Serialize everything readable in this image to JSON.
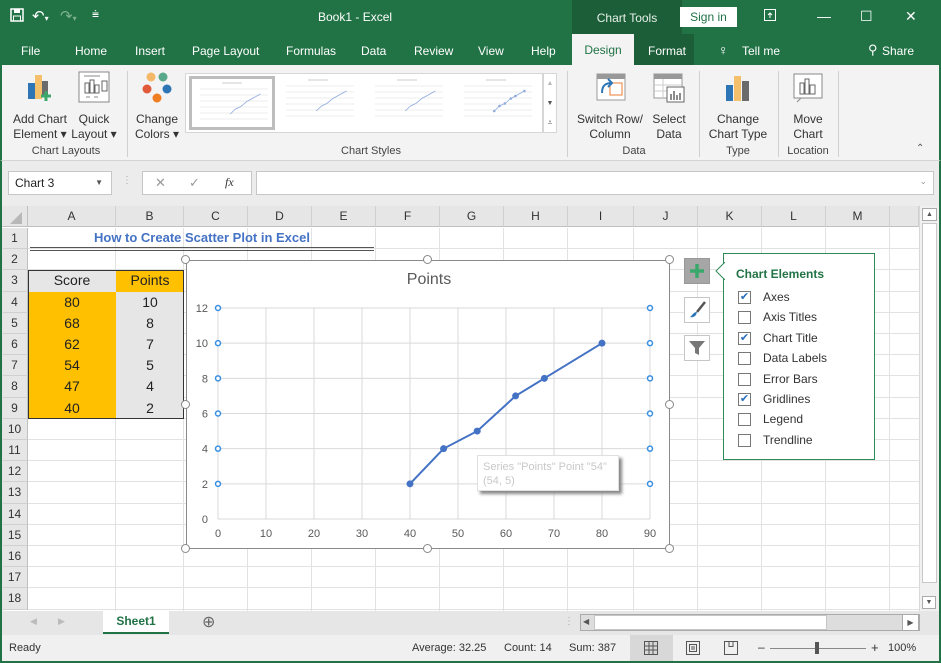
{
  "window": {
    "title": "Book1  -  Excel",
    "context_group": "Chart Tools",
    "sign_in": "Sign in",
    "icons": {
      "save": "save-icon",
      "undo": "undo-icon",
      "redo": "redo-icon",
      "customize": "customize-qat-icon",
      "ribbon_display": "ribbon-display-icon",
      "minimize": "minimize-icon",
      "maximize": "maximize-icon",
      "close": "close-icon"
    }
  },
  "tabs": [
    "File",
    "Home",
    "Insert",
    "Page Layout",
    "Formulas",
    "Data",
    "Review",
    "View",
    "Help",
    "Design",
    "Format"
  ],
  "active_tab": "Design",
  "tell_me": "Tell me",
  "share": "Share",
  "ribbon": {
    "groups": [
      {
        "label": "Chart Layouts",
        "buttons": [
          {
            "line1": "Add Chart",
            "line2": "Element ▾"
          },
          {
            "line1": "Quick",
            "line2": "Layout ▾"
          }
        ]
      },
      {
        "label": "Chart Styles",
        "buttons": [
          {
            "line1": "Change",
            "line2": "Colors ▾"
          }
        ]
      },
      {
        "label": "Data",
        "buttons": [
          {
            "line1": "Switch Row/",
            "line2": "Column"
          },
          {
            "line1": "Select",
            "line2": "Data"
          }
        ]
      },
      {
        "label": "Type",
        "buttons": [
          {
            "line1": "Change",
            "line2": "Chart Type"
          }
        ]
      },
      {
        "label": "Location",
        "buttons": [
          {
            "line1": "Move",
            "line2": "Chart"
          }
        ]
      }
    ],
    "gallery_styles": 4,
    "gallery_selected": 1
  },
  "formula_bar": {
    "name_box": "Chart 3",
    "cancel": "✕",
    "enter": "✓",
    "fx": "fx",
    "value": ""
  },
  "sheet": {
    "columns": [
      "A",
      "B",
      "C",
      "D",
      "E",
      "F",
      "G",
      "H",
      "I",
      "J",
      "K",
      "L",
      "M"
    ],
    "rows": [
      "1",
      "2",
      "3",
      "4",
      "5",
      "6",
      "7",
      "8",
      "9",
      "10",
      "11",
      "12",
      "13",
      "14",
      "15",
      "16",
      "17",
      "18"
    ],
    "title_cell": "How to Create Scatter Plot in Excel",
    "table": {
      "headers": [
        "Score",
        "Points"
      ],
      "rows": [
        [
          "80",
          "10"
        ],
        [
          "68",
          "8"
        ],
        [
          "62",
          "7"
        ],
        [
          "54",
          "5"
        ],
        [
          "47",
          "4"
        ],
        [
          "40",
          "2"
        ]
      ]
    },
    "colors": {
      "score_fill": "#ffc000",
      "points_fill": "#e7e6e6",
      "title_text": "#4472c4",
      "header_fill": "#e7e6e6"
    }
  },
  "chart_data": {
    "type": "scatter",
    "title": "Points",
    "series": [
      {
        "name": "Points",
        "x": [
          80,
          68,
          62,
          54,
          47,
          40
        ],
        "y": [
          10,
          8,
          7,
          5,
          4,
          2
        ],
        "color": "#4472c4",
        "style": "lines-with-markers"
      }
    ],
    "xlabel": "",
    "ylabel": "",
    "xlim": [
      0,
      90
    ],
    "ylim": [
      0,
      12
    ],
    "xticks": [
      0,
      10,
      20,
      30,
      40,
      50,
      60,
      70,
      80,
      90
    ],
    "yticks": [
      0,
      2,
      4,
      6,
      8,
      10,
      12
    ],
    "grid": true,
    "legend": "none",
    "tooltip": {
      "line1": "Series \"Points\" Point \"54\"",
      "line2": "(54, 5)"
    }
  },
  "chart_elements": {
    "title": "Chart Elements",
    "items": [
      {
        "label": "Axes",
        "checked": true
      },
      {
        "label": "Axis Titles",
        "checked": false
      },
      {
        "label": "Chart Title",
        "checked": true
      },
      {
        "label": "Data Labels",
        "checked": false
      },
      {
        "label": "Error Bars",
        "checked": false
      },
      {
        "label": "Gridlines",
        "checked": true
      },
      {
        "label": "Legend",
        "checked": false
      },
      {
        "label": "Trendline",
        "checked": false
      }
    ]
  },
  "sheet_tabs": {
    "active": "Sheet1",
    "add": "⊕"
  },
  "status": {
    "ready": "Ready",
    "average": "Average: 32.25",
    "count": "Count: 14",
    "sum": "Sum: 387",
    "zoom": "100%",
    "zoom_minus": "–",
    "zoom_plus": "+"
  }
}
